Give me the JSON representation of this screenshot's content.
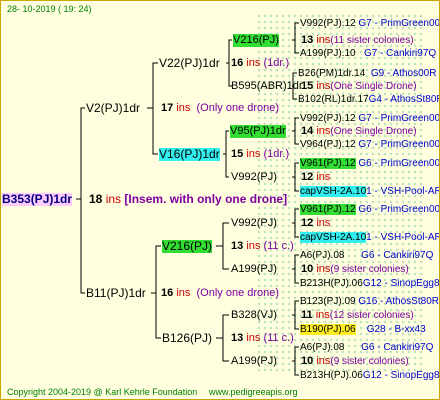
{
  "header": {
    "date": "28- 10-2019 ( 19: 24)"
  },
  "root": {
    "name": "B353(PJ)1dr",
    "num": "18",
    "ins": "ins",
    "note": "[Insem. with only one drone]"
  },
  "gen1": [
    {
      "name": "V2(PJ)1dr",
      "num": "17",
      "ins": "ins",
      "note": "(Only one drone)"
    },
    {
      "name": "B11(PJ)1dr",
      "num": "16",
      "ins": "ins",
      "note": "(Only one drone)"
    }
  ],
  "gen2": [
    {
      "name": "V22(PJ)1dr",
      "num": "16",
      "ins": "ins",
      "note": "(1dr.)"
    },
    {
      "name": "V16(PJ)1dr",
      "num": "15",
      "ins": "ins",
      "note": "(1dr.)"
    },
    {
      "name": "V216(PJ)",
      "num": "13",
      "ins": "ins",
      "note": "(11 c.)"
    },
    {
      "name": "B126(PJ)",
      "num": "13",
      "ins": "ins",
      "note": "(11 c.)"
    }
  ],
  "gen3": [
    {
      "name": "V216(PJ)",
      "num": "13",
      "ins": "ins",
      "note": "(11 sister colonies)"
    },
    {
      "name": "B595(ABR)1dr",
      "num": "15",
      "ins": "ins",
      "note": "(One Single Drone)"
    },
    {
      "name": "V95(PJ)1dr",
      "num": "14",
      "ins": "ins",
      "note": "(One Single Drone)"
    },
    {
      "name": "V992(PJ)",
      "num": "12",
      "ins": "ins",
      "note": ""
    },
    {
      "name": "V992(PJ)",
      "num": "12",
      "ins": "ins",
      "note": ""
    },
    {
      "name": "A199(PJ)",
      "num": "10",
      "ins": "ins",
      "note": "(9 sister colonies)"
    },
    {
      "name": "B328(VJ)",
      "num": "11",
      "ins": "ins",
      "note": "(12 sister colonies)"
    },
    {
      "name": "A199(PJ)",
      "num": "10",
      "ins": "ins",
      "note": "(9 sister colonies)"
    }
  ],
  "gen4": [
    {
      "name": "V992(PJ).12",
      "info": "G7 - PrimGreen00"
    },
    {
      "name": "A199(PJ).10",
      "info": "G7 - Cankiri97Q"
    },
    {
      "name": "B26(PM)1dr.14",
      "info": "G9 - Athos00R"
    },
    {
      "name": "B102(RL)1dr.17",
      "info": "G4 - AthosSt80R"
    },
    {
      "name": "V992(PJ).12",
      "info": "G7 - PrimGreen00"
    },
    {
      "name": "V964(PJ).12",
      "info": "G7 - PrimGreen00"
    },
    {
      "name": "V961(PJ).12",
      "info": "G6 - PrimGreen00"
    },
    {
      "name": "capVSH-2A.10",
      "info": "1 - VSH-Pool-AR"
    },
    {
      "name": "V961(PJ).12",
      "info": "G6 - PrimGreen00"
    },
    {
      "name": "capVSH-2A.10",
      "info": "1 - VSH-Pool-AR"
    },
    {
      "name": "A6(PJ).08",
      "info": "G6 - Cankiri97Q"
    },
    {
      "name": "B213H(PJ).06",
      "info": "G12 - SinopEgg86R"
    },
    {
      "name": "B123(PJ).09",
      "info": "G16 - AthosSt80R"
    },
    {
      "name": "B190(PJ).06",
      "info": "G28 - B-xx43"
    },
    {
      "name": "A6(PJ).08",
      "info": "G6 - Cankiri97Q"
    },
    {
      "name": "B213H(PJ).06",
      "info": "G12 - SinopEgg86R"
    }
  ],
  "footer": {
    "copyright": "Copyright 2004-2019 @ Karl Kehrle Foundation",
    "site": "www.pedigreeapis.org"
  }
}
